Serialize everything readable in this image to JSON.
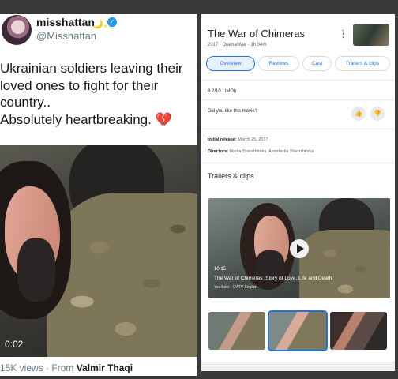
{
  "tweet": {
    "name": "misshattan",
    "handle": "@Misshattan",
    "name_emoji": "🌙✨",
    "verified_mark": "✓",
    "text": "Ukrainian soldiers leaving their\nloved ones to fight for their\ncountry..\nAbsolutely heartbreaking.",
    "heart_emoji": "💔",
    "video_time": "0:02",
    "views": "15K views",
    "separator": "·",
    "from_label": "From",
    "from_name": "Valmir Thaqi"
  },
  "movie": {
    "title": "The War of Chimeras",
    "menu_glyph": "⋮",
    "meta": "2017 · Drama/War · 1h 34m",
    "chips": [
      "Overview",
      "Reviews",
      "Cast",
      "Trailers & clips"
    ],
    "rating": "8.2/10 · IMDb",
    "like_question": "Did you like this movie?",
    "thumb_up": "👍",
    "thumb_down": "👎",
    "release_label": "Initial release:",
    "release_value": "March 25, 2017",
    "directors_label": "Directors:",
    "directors_value": "Mariia Starozhitska, Anastasiia Starozhitska",
    "trailers_heading": "Trailers & clips",
    "clip": {
      "duration": "10:15",
      "title": "The War of Chimeras: Story of Love, Life and Death",
      "source": "YouTube · UATV English"
    }
  },
  "colors": {
    "accent": "#1a73e8",
    "tweet_text": "#14171a",
    "muted": "#657786",
    "heart": "#d0323c",
    "verified": "#1d9bf0"
  }
}
